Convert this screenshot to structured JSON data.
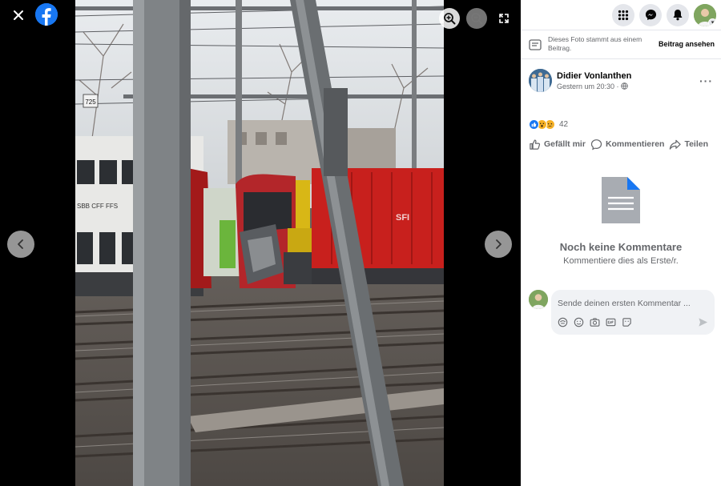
{
  "viewer": {
    "close_icon": "close-icon",
    "logo_icon": "facebook-logo-icon",
    "zoom_in_icon": "zoom-in-icon",
    "zoom_out_icon": "zoom-out-icon",
    "fullscreen_icon": "fullscreen-icon",
    "prev_icon": "chevron-left-icon",
    "next_icon": "chevron-right-icon",
    "photo_sign": "725",
    "photo_train_text": "SBB CFF FFS",
    "photo_train_text2": "SFI"
  },
  "topbar": {
    "menu_icon": "grid-menu-icon",
    "messenger_icon": "messenger-icon",
    "notifications_icon": "bell-icon",
    "profile_icon": "profile-avatar"
  },
  "notice": {
    "text": "Dieses Foto stammt aus einem Beitrag.",
    "link": "Beitrag ansehen"
  },
  "post": {
    "author": "Didier Vonlanthen",
    "time": "Gestern um 20:30 ·",
    "audience_icon": "globe-icon",
    "more": "···",
    "reaction_count": "42"
  },
  "actions": {
    "like": "Gefällt mir",
    "comment": "Kommentieren",
    "share": "Teilen"
  },
  "empty_state": {
    "title": "Noch keine Kommentare",
    "subtitle": "Kommentiere dies als Erste/r."
  },
  "composer": {
    "placeholder": "Sende deinen ersten Kommentar ...",
    "tools": [
      "avatar-sticker-icon",
      "emoji-icon",
      "camera-icon",
      "gif-icon",
      "sticker-icon"
    ],
    "send_icon": "send-icon"
  },
  "colors": {
    "brand": "#1877f2",
    "panel_bg": "#ffffff",
    "viewer_bg": "#000000",
    "muted_text": "#65676b"
  }
}
